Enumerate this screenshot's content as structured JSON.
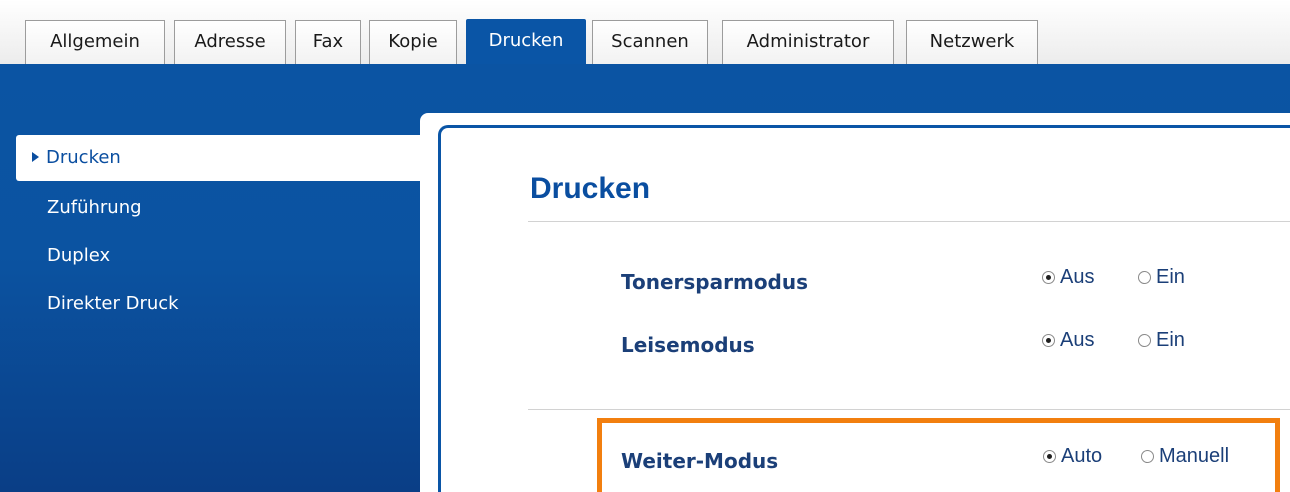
{
  "tabs": [
    {
      "label": "Allgemein",
      "active": false
    },
    {
      "label": "Adresse",
      "active": false
    },
    {
      "label": "Fax",
      "active": false
    },
    {
      "label": "Kopie",
      "active": false
    },
    {
      "label": "Drucken",
      "active": true
    },
    {
      "label": "Scannen",
      "active": false
    },
    {
      "label": "Administrator",
      "active": false
    },
    {
      "label": "Netzwerk",
      "active": false
    }
  ],
  "sidebar": {
    "items": [
      {
        "label": "Drucken",
        "active": true
      },
      {
        "label": "Zuführung",
        "active": false
      },
      {
        "label": "Duplex",
        "active": false
      },
      {
        "label": "Direkter Druck",
        "active": false
      }
    ]
  },
  "main": {
    "title": "Drucken",
    "settings": [
      {
        "label": "Tonersparmodus",
        "options": [
          "Aus",
          "Ein"
        ],
        "selected": "Aus"
      },
      {
        "label": "Leisemodus",
        "options": [
          "Aus",
          "Ein"
        ],
        "selected": "Aus"
      },
      {
        "label": "Weiter-Modus",
        "options": [
          "Auto",
          "Manuell"
        ],
        "selected": "Auto"
      }
    ]
  },
  "colors": {
    "brand_blue": "#0a55a6",
    "highlight_orange": "#f27f0f",
    "label_navy": "#1b3f78"
  }
}
